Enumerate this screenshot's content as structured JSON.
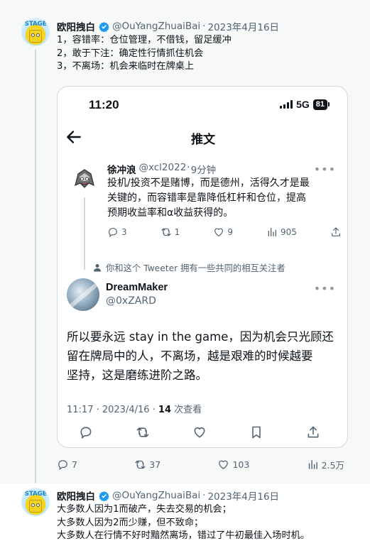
{
  "tweet1": {
    "author_name": "欧阳拽白",
    "handle": "@OuYangZhuaiBai",
    "separator": "·",
    "date": "2023年4月16日",
    "lines": [
      "1，容错率：仓位管理，不借钱，留足缓冲",
      "2，敢于下注：确定性行情抓住机会",
      "3，不离场：机会来临时在牌桌上"
    ],
    "stats": {
      "replies": "7",
      "retweets": "37",
      "likes": "103",
      "views": "2.5万"
    }
  },
  "screenshot": {
    "status_time": "11:20",
    "network": "5G",
    "battery": "81",
    "nav_title": "推文",
    "reply": {
      "author_name": "徐冲浪",
      "handle": "@xcl2022",
      "separator": "·",
      "time": "9分钟",
      "more": "•••",
      "lines": [
        "投机/投资不是赌博，而是德州，活得久才是最",
        "关键的，而容错率是靠降低杠杆和仓位，提高",
        "预期收益率和α收益获得的。"
      ],
      "stats": {
        "replies": "3",
        "retweets": "1",
        "likes": "9",
        "views": "905"
      }
    },
    "social_context": "你和这个 Tweeter 拥有一些共同的相互关注者",
    "main": {
      "author_name": "DreamMaker",
      "handle": "@0xZARD",
      "more": "•••",
      "lines": [
        "所以要永远 stay in the game，因为机会只光顾还",
        "留在牌局中的人，不离场，越是艰难的时候越要",
        "坚持，这是磨练进阶之路。"
      ],
      "meta_time": "11:17 · 2023/4/16 · ",
      "meta_views": "14",
      "meta_views_label": " 次查看"
    }
  },
  "tweet2": {
    "author_name": "欧阳拽白",
    "handle": "@OuYangZhuaiBai",
    "separator": "·",
    "date": "2023年4月16日",
    "lines": [
      "大多数人因为1而破产，失去交易的机会；",
      "大多数人因为2而少赚，但不致命；",
      "大多数人在行情不好时黯然离场，错过了牛初最佳入场时机。"
    ]
  },
  "colors": {
    "text": "#0f1419",
    "secondary": "#536471",
    "verified": "#1d9bf0",
    "border": "#cfd9de"
  }
}
